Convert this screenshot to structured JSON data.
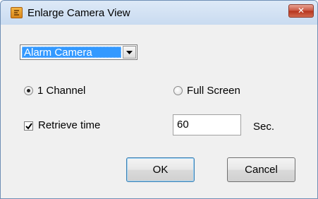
{
  "window": {
    "title": "Enlarge Camera View",
    "close_symbol": "✕",
    "icon": "app-icon"
  },
  "camera_select": {
    "selected": "Alarm Camera"
  },
  "channel": {
    "option_1_label": "1 Channel",
    "option_2_label": "Full Screen",
    "selected": "1 Channel"
  },
  "retrieve": {
    "checkbox_label": "Retrieve time",
    "checked": true,
    "value": "60",
    "unit": "Sec."
  },
  "buttons": {
    "ok_label": "OK",
    "cancel_label": "Cancel"
  }
}
